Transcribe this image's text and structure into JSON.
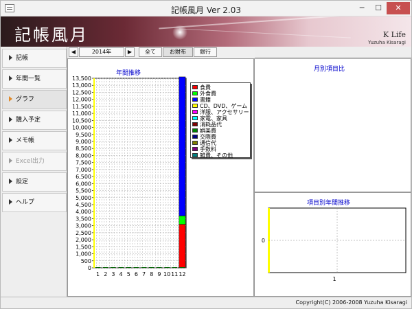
{
  "window": {
    "title": "記帳風月 Ver 2.03",
    "controls": {
      "minimize": "─",
      "maximize": "☐",
      "close": "✕"
    }
  },
  "banner": {
    "logo": "記帳風月",
    "brand": "K Life",
    "author": "Yuzuha Kisaragi"
  },
  "sidebar": {
    "items": [
      {
        "label": "記帳",
        "state": "normal"
      },
      {
        "label": "年間一覧",
        "state": "normal"
      },
      {
        "label": "グラフ",
        "state": "active"
      },
      {
        "label": "購入予定",
        "state": "normal"
      },
      {
        "label": "メモ帳",
        "state": "normal"
      },
      {
        "label": "Excel出力",
        "state": "disabled"
      },
      {
        "label": "設定",
        "state": "normal"
      },
      {
        "label": "ヘルプ",
        "state": "normal"
      }
    ]
  },
  "toolbar": {
    "prev": "◀",
    "year": "2014年",
    "next": "▶",
    "tabs": [
      "全て",
      "お財布",
      "銀行"
    ],
    "selected_tab": "お財布"
  },
  "panels": {
    "yearly_title": "年間推移",
    "monthly_title": "月別項目比",
    "item_yearly_title": "項目別年間推移"
  },
  "colors": {
    "food": "#ff0000",
    "eating_out": "#00ff00",
    "books": "#0000ff",
    "cd_dvd_game": "#ffff00",
    "clothes": "#ff00ff",
    "appliances": "#00ffff",
    "consumables": "#800000",
    "entertainment": "#008000",
    "social": "#000080",
    "communication": "#808000",
    "fees": "#800080",
    "misc": "#008080"
  },
  "chart_data": [
    {
      "type": "bar",
      "title": "年間推移",
      "stacked": true,
      "categories": [
        "1",
        "2",
        "3",
        "4",
        "5",
        "6",
        "7",
        "8",
        "9",
        "10",
        "11",
        "12"
      ],
      "ylim": [
        0,
        13500
      ],
      "yticks": [
        0,
        500,
        1000,
        1500,
        2000,
        2500,
        3000,
        3500,
        4000,
        4500,
        5000,
        5500,
        6000,
        6500,
        7000,
        7500,
        8000,
        8500,
        9000,
        9500,
        10000,
        10500,
        11000,
        11500,
        12000,
        12500,
        13000,
        13500
      ],
      "grid": true,
      "legend_position": "right",
      "series": [
        {
          "name": "食費",
          "color": "#ff0000",
          "values": [
            0,
            0,
            0,
            0,
            0,
            0,
            0,
            0,
            0,
            0,
            0,
            3100
          ]
        },
        {
          "name": "外食費",
          "color": "#00ff00",
          "values": [
            0,
            0,
            0,
            0,
            0,
            0,
            0,
            0,
            0,
            0,
            0,
            600
          ]
        },
        {
          "name": "書籍",
          "color": "#0000ff",
          "values": [
            0,
            0,
            0,
            0,
            0,
            0,
            0,
            0,
            0,
            0,
            0,
            9900
          ]
        },
        {
          "name": "CD、DVD、ゲーム",
          "color": "#ffff00",
          "values": [
            0,
            0,
            0,
            0,
            0,
            0,
            0,
            0,
            0,
            0,
            0,
            0
          ]
        },
        {
          "name": "洋服、アクセサリー",
          "color": "#ff00ff",
          "values": [
            0,
            0,
            0,
            0,
            0,
            0,
            0,
            0,
            0,
            0,
            0,
            0
          ]
        },
        {
          "name": "家電、家具",
          "color": "#00ffff",
          "values": [
            0,
            0,
            0,
            0,
            0,
            0,
            0,
            0,
            0,
            0,
            0,
            0
          ]
        },
        {
          "name": "消耗品代",
          "color": "#800000",
          "values": [
            0,
            0,
            0,
            0,
            0,
            0,
            0,
            0,
            0,
            0,
            0,
            0
          ]
        },
        {
          "name": "娯楽費",
          "color": "#008000",
          "values": [
            0,
            0,
            0,
            0,
            0,
            0,
            0,
            0,
            0,
            0,
            0,
            0
          ]
        },
        {
          "name": "交際費",
          "color": "#000080",
          "values": [
            0,
            0,
            0,
            0,
            0,
            0,
            0,
            0,
            0,
            0,
            0,
            0
          ]
        },
        {
          "name": "通信代",
          "color": "#808000",
          "values": [
            0,
            0,
            0,
            0,
            0,
            0,
            0,
            0,
            0,
            0,
            0,
            0
          ]
        },
        {
          "name": "手数料",
          "color": "#800080",
          "values": [
            0,
            0,
            0,
            0,
            0,
            0,
            0,
            0,
            0,
            0,
            0,
            0
          ]
        },
        {
          "name": "雑費、その他",
          "color": "#008080",
          "values": [
            0,
            0,
            0,
            0,
            0,
            0,
            0,
            0,
            0,
            0,
            0,
            0
          ]
        }
      ]
    },
    {
      "type": "line",
      "title": "項目別年間推移",
      "categories": [
        "1"
      ],
      "yticks": [
        0
      ],
      "grid": true,
      "series": []
    }
  ],
  "statusbar": {
    "copyright": "Copyright(C) 2006-2008 Yuzuha Kisaragi"
  }
}
